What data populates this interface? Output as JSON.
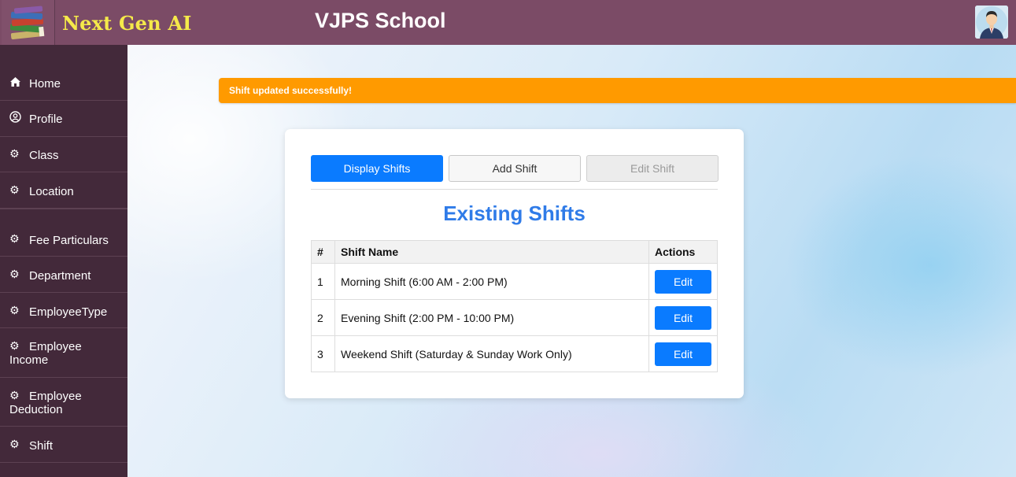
{
  "header": {
    "brand": "Next Gen AI",
    "school_name": "VJPS School",
    "logo_icon": "books-stack-icon",
    "avatar_icon": "user-avatar-icon"
  },
  "sidebar": {
    "items": [
      {
        "label": "Home",
        "icon": "home-icon"
      },
      {
        "label": "Profile",
        "icon": "user-circle-icon"
      },
      {
        "label": "Class",
        "icon": "gear-icon"
      },
      {
        "label": "Location",
        "icon": "gear-icon"
      },
      {
        "label": "Fee Particulars",
        "icon": "gear-icon"
      },
      {
        "label": "Department",
        "icon": "gear-icon"
      },
      {
        "label": "EmployeeType",
        "icon": "gear-icon"
      },
      {
        "label": "Employee Income",
        "icon": "gear-icon"
      },
      {
        "label": "Employee Deduction",
        "icon": "gear-icon"
      },
      {
        "label": "Shift",
        "icon": "gear-icon"
      }
    ]
  },
  "alert": {
    "message": "Shift updated successfully!",
    "color": "#ff9a00"
  },
  "tabs": {
    "display": "Display Shifts",
    "add": "Add Shift",
    "edit": "Edit Shift"
  },
  "section_title": "Existing Shifts",
  "table": {
    "headers": {
      "num": "#",
      "name": "Shift Name",
      "actions": "Actions"
    },
    "rows": [
      {
        "num": "1",
        "name": "Morning Shift (6:00 AM - 2:00 PM)",
        "action": "Edit"
      },
      {
        "num": "2",
        "name": "Evening Shift (2:00 PM - 10:00 PM)",
        "action": "Edit"
      },
      {
        "num": "3",
        "name": "Weekend Shift (Saturday & Sunday Work Only)",
        "action": "Edit"
      }
    ]
  },
  "colors": {
    "header_bg": "#7b4b66",
    "sidebar_bg": "#43293a",
    "brand_text": "#f5e94a",
    "primary": "#0a7bff",
    "title_text": "#2f7be8"
  }
}
